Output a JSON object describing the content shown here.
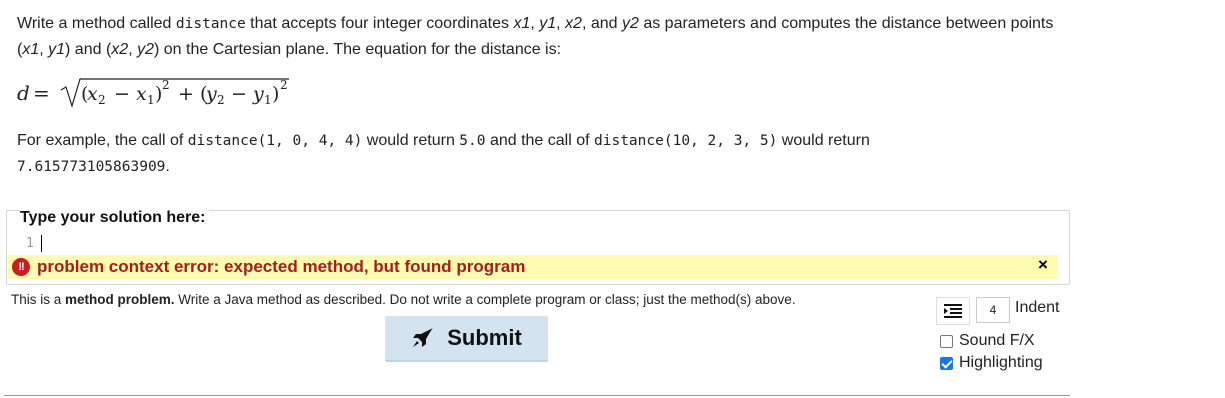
{
  "problem": {
    "p1_a": "Write a method called ",
    "p1_code": "distance",
    "p1_b": " that accepts four integer coordinates ",
    "x1": "x1",
    "sep1": ", ",
    "y1": "y1",
    "sep2": ", ",
    "x2": "x2",
    "sep3": ", and ",
    "y2": "y2",
    "p1_c": " as parameters and computes the distance between points (",
    "pt1_x": "x1",
    "pt1_sep": ", ",
    "pt1_y": "y1",
    "p1_d": ") and (",
    "pt2_x": "x2",
    "pt2_sep": ", ",
    "pt2_y": "y2",
    "p1_e": ") on the Cartesian plane. The equation for the distance is:",
    "p2_a": "For example, the call of ",
    "call1": "distance(1, 0, 4, 4)",
    "p2_b": " would return ",
    "ret1": "5.0",
    "p2_c": " and the call of ",
    "call2": "distance(10, 2, 3, 5)",
    "p2_d": " would return ",
    "ret2": "7.615773105863909",
    "p2_e": "."
  },
  "equation": {
    "lhs": "d",
    "eq": "=",
    "open1": "(",
    "x2": "x",
    "x2_sub": "2",
    "minus1": "−",
    "x1": "x",
    "x1_sub": "1",
    "close1": ")",
    "sq1": "2",
    "plus": "+",
    "open2": "(",
    "y2": "y",
    "y2_sub": "2",
    "minus2": "−",
    "y1": "y",
    "y1_sub": "1",
    "close2": ")",
    "sq2": "2"
  },
  "editor": {
    "legend": "Type your solution here:",
    "line_number": "1",
    "error_icon": "!!",
    "error_text": "problem context error: expected method, but found program",
    "error_close": "×",
    "error_bg": "#fffcb0",
    "error_color": "#a51d1d"
  },
  "hint": {
    "a": "This is a ",
    "bold": "method problem.",
    "b": " Write a Java method as described. Do not write a complete program or class; just the method(s) above."
  },
  "controls": {
    "submit_label": "Submit",
    "submit_icon": "rocket-icon",
    "indent_icon": "indent-icon",
    "indent_value": "4",
    "indent_label": "Indent",
    "sound_label": "Sound F/X",
    "sound_checked": false,
    "highlight_label": "Highlighting",
    "highlight_checked": true,
    "accent": "#1a73e8",
    "submit_bg": "#d3e3ef"
  }
}
